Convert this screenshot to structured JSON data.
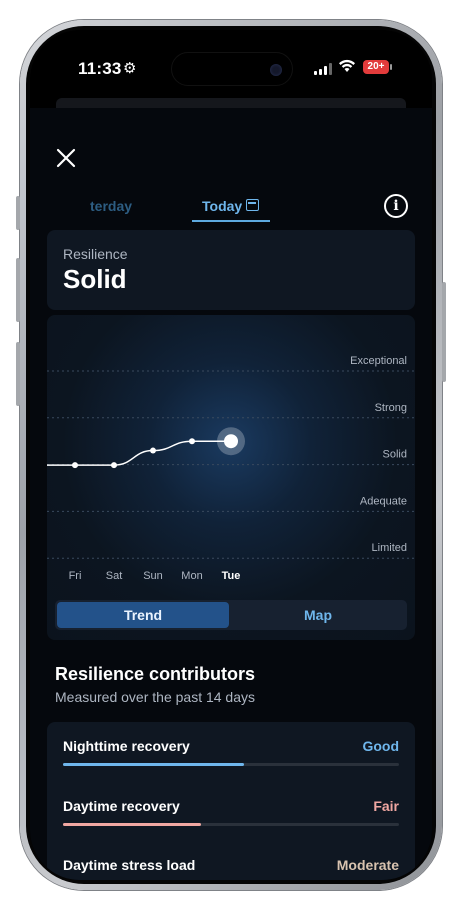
{
  "status_bar": {
    "time": "11:33",
    "settings_glyph": "⚙",
    "wifi_glyph": "◉",
    "battery": "20+"
  },
  "header": {
    "close_glyph": "✕",
    "tabs": [
      {
        "label": "terday",
        "active": false
      },
      {
        "label": "Today",
        "active": true
      }
    ],
    "info_glyph": "i"
  },
  "resilience": {
    "label": "Resilience",
    "value": "Solid"
  },
  "chart_data": {
    "type": "line",
    "categories": [
      "Fri",
      "Sat",
      "Sun",
      "Mon",
      "Tue"
    ],
    "levels": [
      "Limited",
      "Adequate",
      "Solid",
      "Strong",
      "Exceptional"
    ],
    "values": [
      2.99,
      2.99,
      3.3,
      3.5,
      3.5
    ],
    "highlight_index": 4,
    "ylim": [
      1,
      5
    ]
  },
  "view_toggle": {
    "trend": "Trend",
    "map": "Map",
    "selected": "Trend"
  },
  "contributors": {
    "title": "Resilience contributors",
    "subtitle": "Measured over the past 14 days",
    "items": [
      {
        "name": "Nighttime recovery",
        "status": "Good",
        "status_color": "#6fb6ec",
        "fill_color": "#6fb6ec",
        "fill_fraction": 0.54
      },
      {
        "name": "Daytime recovery",
        "status": "Fair",
        "status_color": "#f0a7a2",
        "fill_color": "#f0a7a2",
        "fill_fraction": 0.41
      },
      {
        "name": "Daytime stress load",
        "status": "Moderate",
        "status_color": "#d8c3b0",
        "fill_color": "#d8c3b0",
        "fill_fraction": 0.6
      }
    ]
  }
}
